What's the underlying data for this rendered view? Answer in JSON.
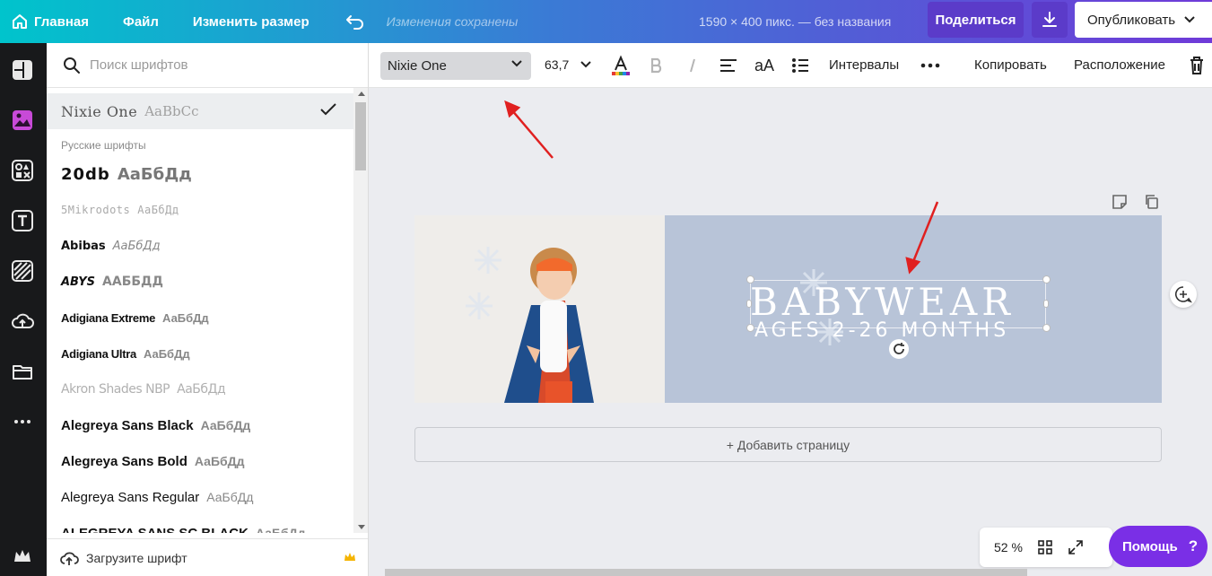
{
  "topbar": {
    "home": "Главная",
    "file": "Файл",
    "resize": "Изменить размер",
    "saved_status": "Изменения сохранены",
    "dimensions": "1590 × 400 пикс. — без названия",
    "share": "Поделиться",
    "publish": "Опубликовать"
  },
  "font_panel": {
    "search_placeholder": "Поиск шрифтов",
    "selected": {
      "name": "Nixie One",
      "sample": "AaBbCc"
    },
    "section_title": "Русские шрифты",
    "fonts": [
      {
        "name": "20db",
        "sample": "АаБбДд"
      },
      {
        "name": "5Mikrodots",
        "sample": "АаБбДд"
      },
      {
        "name": "Abibas",
        "sample": "АаБбДд"
      },
      {
        "name": "ABYS",
        "sample": "ААББДД"
      },
      {
        "name": "Adigiana Extreme",
        "sample": "АаБбДд"
      },
      {
        "name": "Adigiana Ultra",
        "sample": "АаБбДд"
      },
      {
        "name": "Akron Shades NBP",
        "sample": "АаБбДд"
      },
      {
        "name": "Alegreya Sans Black",
        "sample": "АаБбДд"
      },
      {
        "name": "Alegreya Sans Bold",
        "sample": "АаБбДд"
      },
      {
        "name": "Alegreya Sans Regular",
        "sample": "АаБбДд"
      },
      {
        "name": "Alegreya Sans SC Black",
        "sample": "АаБбДд"
      }
    ],
    "upload_label": "Загрузите шрифт"
  },
  "text_toolbar": {
    "font_name": "Nixie One",
    "font_size": "63,7",
    "case_label": "aA",
    "spacing_label": "Интервалы",
    "copy_label": "Копировать",
    "position_label": "Расположение"
  },
  "canvas": {
    "title_text": "BABYWEAR",
    "subtitle_text": "AGES 2-26 MONTHS",
    "add_page": "+ Добавить страницу",
    "zoom": "52 %",
    "help": "Помощь",
    "help_q": "?"
  },
  "colors": {
    "accent": "#7a2fe6",
    "page_background": "#b8c4d8",
    "arrow": "#e02020"
  }
}
